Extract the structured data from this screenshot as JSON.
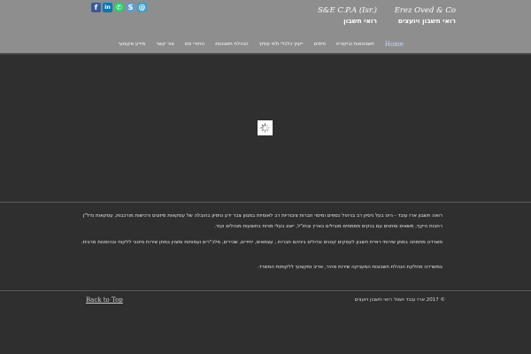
{
  "header": {
    "brand_left_title": "S&E C.P.A (Isr.)",
    "brand_left_sub": "רואי חשבון",
    "brand_right_title": "Erez Oved & Co",
    "brand_right_sub": "רואי חשבון ויועצים",
    "background": "#8e8e8e"
  },
  "social": [
    {
      "name": "facebook-icon",
      "glyph": "f",
      "color": "#3b5998"
    },
    {
      "name": "linkedin-icon",
      "glyph": "in",
      "color": "#0077b5"
    },
    {
      "name": "whatsapp-icon",
      "glyph": "✆",
      "color": "#25d366"
    },
    {
      "name": "skype-icon",
      "glyph": "S",
      "color": "#5a9fd4"
    },
    {
      "name": "email-icon",
      "glyph": "@",
      "color": "#3aa1c9"
    }
  ],
  "nav": {
    "items": [
      "מידע מקצועי",
      "צור קשר",
      "החזרי מס",
      "הנהלת חשבונות",
      "ייעוץ כלכלי ולווי עסקי",
      "מיסים",
      "חשבונאות וביקורת",
      "Home"
    ],
    "active": "Home"
  },
  "main": {
    "para1": "רואה חשבון ארז עובד - הינו בעל ניסיון רב בניהול כספים ומיסוי חברות ציבוריות רב לאומיות במגוון צבר ידע וניסיון בהובלה של עסקאות מיזוגים ורכישות מורכבות, עסקאות נדל\"ן רחבות היקף, משאים ומתנים עם בנקים ממממים מובילים בארץ ובחו\"ל, ייצוג בעלי מניות בחוצעות מנהלים ועוד.",
    "para2": "משרדנו מתמחה במתן שירותי ראיית חשבון לעסקים קטנים וגדולים ביניהם חברות , עצמאים, יחידים, שכירים, מלכ\"רים ועמותות ומצוין במתן שירות מיטבי ללקוח ובהזמנות מרבית.",
    "para3": "במשרדנו מחלקת הנהלת חשבונות המעניקה שירות מהיר, אדיב ומקצועי ללקוחות המשרד."
  },
  "footer": {
    "back_to_top": "Back to Top",
    "copyright": "© 2017 ארז עובד ושות' רואי חשבון ויועצים"
  }
}
